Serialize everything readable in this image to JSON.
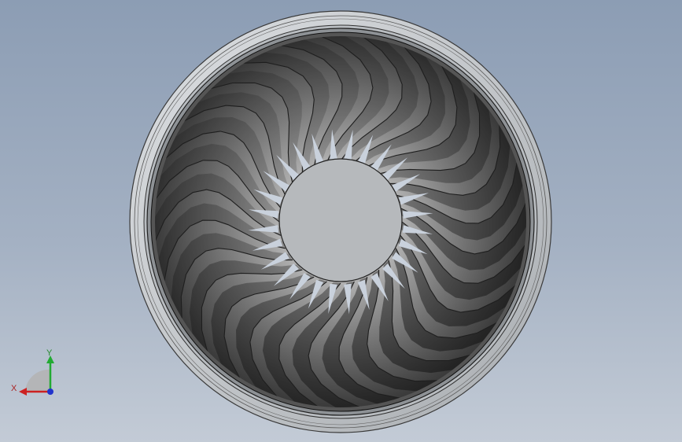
{
  "viewport": {
    "background_top": "#8c9db4",
    "background_bottom": "#c3cbd6"
  },
  "model": {
    "blade_count": 28,
    "blade_color_dark": "#2a2a2a",
    "blade_color_light": "#d8d8d8",
    "hub_color": "#b5b8bb",
    "ring_color": "#c8cbce"
  },
  "triad": {
    "x_label": "X",
    "y_label": "Y",
    "x_color": "#cc2222",
    "y_color": "#22aa33",
    "z_color": "#2233cc"
  }
}
